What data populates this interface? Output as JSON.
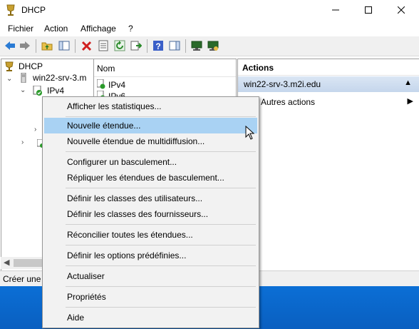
{
  "window": {
    "title": "DHCP",
    "minimize": "—",
    "maximize": "☐",
    "close": "✕"
  },
  "menubar": {
    "items": [
      "Fichier",
      "Action",
      "Affichage",
      "?"
    ]
  },
  "toolbar": {
    "buttons": [
      "back",
      "forward",
      "up-folder",
      "show-hide-console-tree",
      "delete",
      "properties",
      "refresh",
      "export-list",
      "help",
      "show-hide-action-pane",
      "server-monitor",
      "server-connect"
    ]
  },
  "tree": {
    "root": "DHCP",
    "server": "win22-srv-3.m",
    "ipv4": "IPv4"
  },
  "list": {
    "column_name": "Nom",
    "rows": [
      "IPv4",
      "IPv6"
    ]
  },
  "actions": {
    "header": "Actions",
    "group": "win22-srv-3.m2i.edu",
    "items": [
      "Autres actions"
    ]
  },
  "statusbar": {
    "text": "Créer une é"
  },
  "context_menu": {
    "items": [
      "Afficher les statistiques...",
      "Nouvelle étendue...",
      "Nouvelle étendue de multidiffusion...",
      "Configurer un basculement...",
      "Répliquer les étendues de basculement...",
      "Définir les classes des utilisateurs...",
      "Définir les classes des fournisseurs...",
      "Réconcilier toutes les étendues...",
      "Définir les options prédéfinies...",
      "Actualiser",
      "Propriétés",
      "Aide"
    ],
    "highlighted": "Nouvelle étendue..."
  },
  "colors": {
    "highlight": "#a9d2f3",
    "desktop": "#0a64c8",
    "action_group": "#c5d6ec"
  }
}
